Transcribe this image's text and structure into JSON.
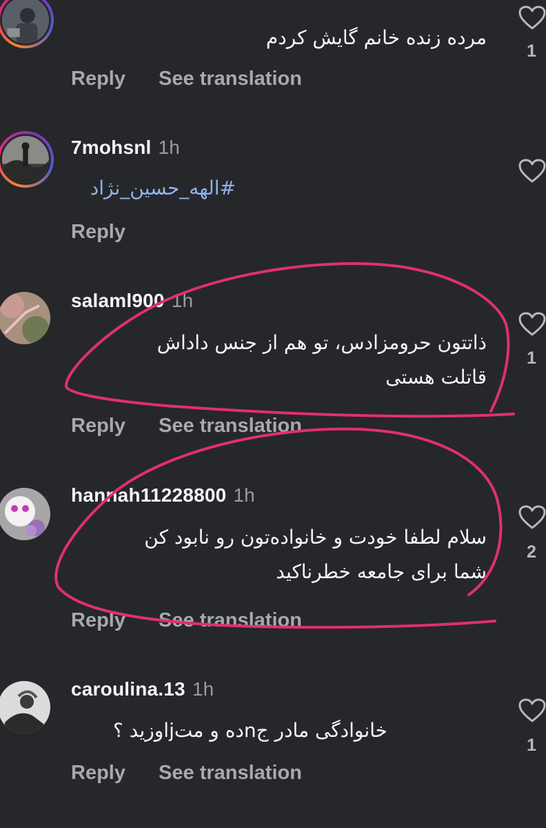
{
  "comments": [
    {
      "username": "",
      "time": "",
      "text": "مرده زنده خانم گایش  کردم",
      "actions": {
        "reply": "Reply",
        "translate": "See translation"
      },
      "likes": "1"
    },
    {
      "username": "7mohsnl",
      "time": "1h",
      "text": "#الهه_حسین_نژاد",
      "actions": {
        "reply": "Reply"
      },
      "likes": ""
    },
    {
      "username": "salaml900",
      "time": "1h",
      "text_lines": [
        "ذاتتون حرومزادس، تو هم از جنس داداش",
        "قاتلت هستی"
      ],
      "actions": {
        "reply": "Reply",
        "translate": "See translation"
      },
      "likes": "1"
    },
    {
      "username": "hannah11228800",
      "time": "1h",
      "text_lines": [
        "سلام لطفا خودت و خانوادەتون رو نابود کن",
        "شما برای جامعه خطرناکید"
      ],
      "actions": {
        "reply": "Reply",
        "translate": "See translation"
      },
      "likes": "2"
    },
    {
      "username": "caroulina.13",
      "time": "1h",
      "text": "خانوادگی مادر جnده و متjاوزید ؟",
      "actions": {
        "reply": "Reply",
        "translate": "See translation"
      },
      "likes": "1"
    }
  ],
  "colors": {
    "background": "#26272b",
    "secondary_text": "#a8a9ae",
    "hashtag": "#8fb2e8",
    "annotation": "#e0306f"
  }
}
